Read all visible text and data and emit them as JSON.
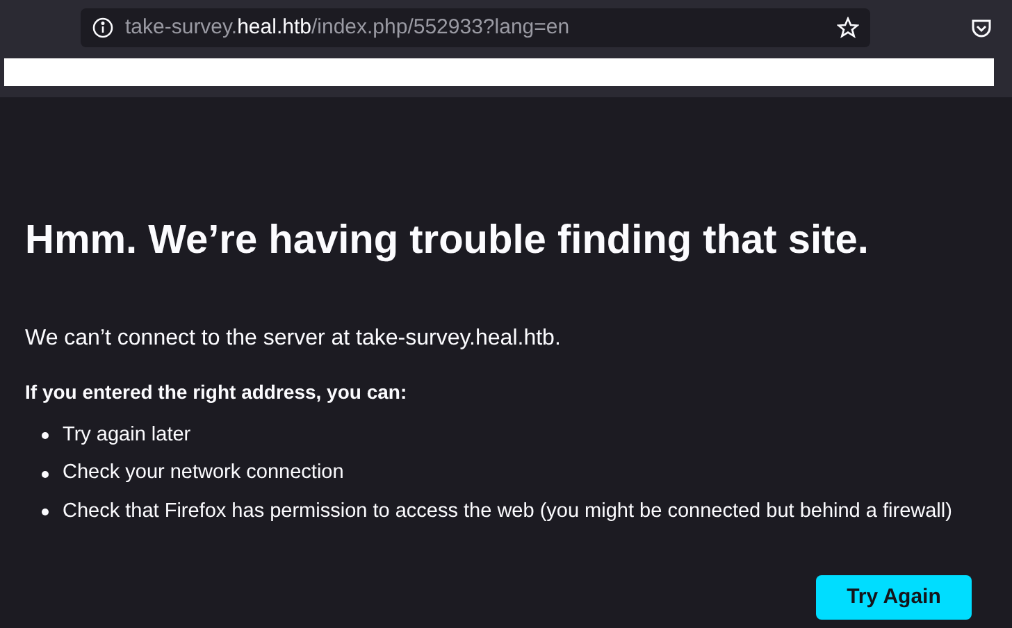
{
  "address_bar": {
    "url_parts": [
      {
        "text": "take-survey.",
        "highlight": false
      },
      {
        "text": "heal.htb",
        "highlight": true
      },
      {
        "text": "/index.php/552933?lang=en",
        "highlight": false
      }
    ]
  },
  "error_page": {
    "title": "Hmm. We’re having trouble finding that site.",
    "message": "We can’t connect to the server at take-survey.heal.htb.",
    "suggestions_heading": "If you entered the right address, you can:",
    "suggestions": [
      "Try again later",
      "Check your network connection",
      "Check that Firefox has permission to access the web (you might be connected but behind a firewall)"
    ],
    "button": "Try Again"
  }
}
